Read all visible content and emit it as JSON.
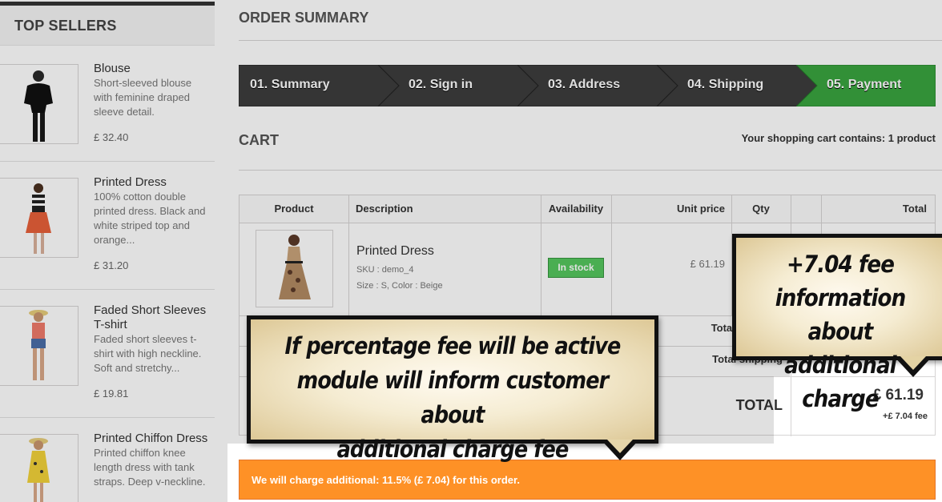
{
  "sidebar": {
    "title": "TOP SELLERS",
    "products": [
      {
        "name": "Blouse",
        "description": "Short-sleeved blouse with feminine draped sleeve detail.",
        "price": "£ 32.40"
      },
      {
        "name": "Printed Dress",
        "description": "100% cotton double printed dress. Black and white striped top and orange...",
        "price": "£ 31.20"
      },
      {
        "name": "Faded Short Sleeves T-shirt",
        "description": "Faded short sleeves t-shirt with high neckline. Soft and stretchy...",
        "price": "£ 19.81"
      },
      {
        "name": "Printed Chiffon Dress",
        "description": "Printed chiffon knee length dress with tank straps. Deep v-neckline.",
        "price": ""
      }
    ]
  },
  "main": {
    "heading": "ORDER SUMMARY",
    "steps": [
      {
        "label": "01. Summary",
        "active": false
      },
      {
        "label": "02. Sign in",
        "active": false
      },
      {
        "label": "03. Address",
        "active": false
      },
      {
        "label": "04. Shipping",
        "active": false
      },
      {
        "label": "05. Payment",
        "active": true
      }
    ],
    "cart": {
      "title": "CART",
      "count_text": "Your shopping cart contains: 1 product",
      "columns": [
        "Product",
        "Description",
        "Availability",
        "Unit price",
        "Qty",
        "",
        "Total"
      ],
      "item": {
        "name": "Printed Dress",
        "sku": "SKU : demo_4",
        "attributes": "Size : S, Color : Beige",
        "availability": "In stock",
        "unit_price": "£ 61.19"
      },
      "total_products_label": "Total products",
      "total_shipping_label": "Total shipping",
      "total_label": "TOTAL",
      "total_value": "£ 61.19",
      "total_fee": "+£ 7.04 fee"
    },
    "notice": "We will charge additional: 11.5% (£ 7.04) for this order."
  },
  "callouts": {
    "left": [
      "If percentage fee will be active",
      "module will inform customer about",
      "additional charge fee"
    ],
    "right": [
      "+7.04 fee",
      "information about",
      "additional charge"
    ]
  },
  "colors": {
    "step_dark": "#3d3d3d",
    "step_active": "#3aa43f",
    "in_stock": "#55c65e",
    "notice_orange": "#fe9126",
    "callout_bg": "#f5ecd2"
  }
}
